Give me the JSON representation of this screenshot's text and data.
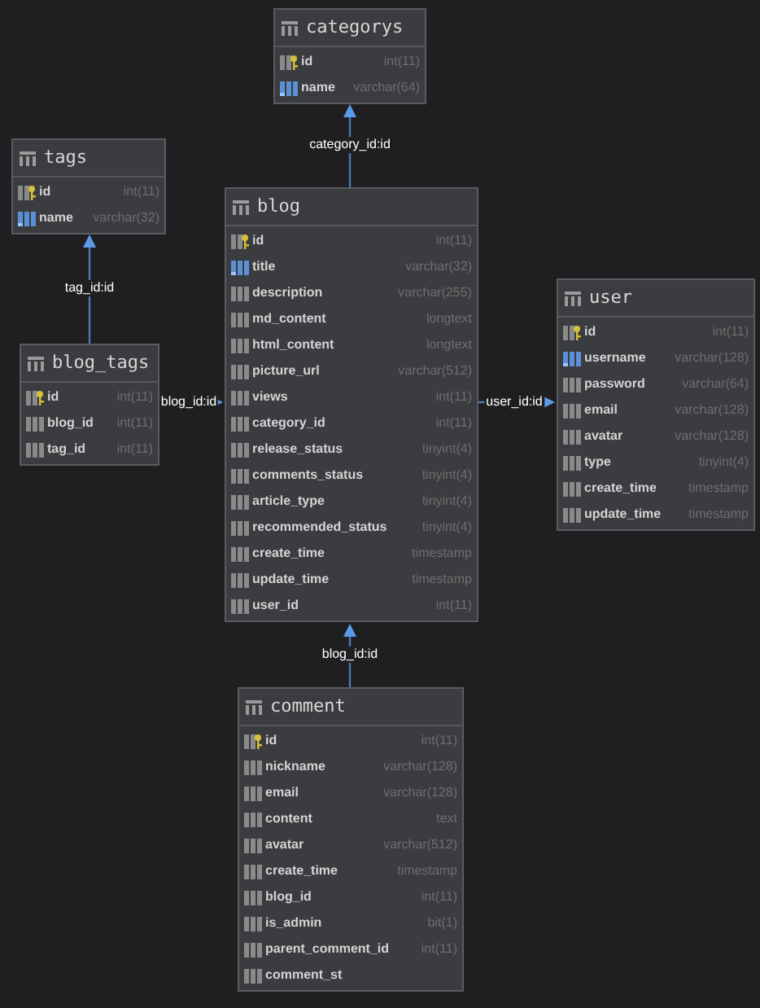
{
  "tables": [
    {
      "name": "categorys",
      "columns": [
        {
          "name": "id",
          "type": "int(11)",
          "kind": "key"
        },
        {
          "name": "name",
          "type": "varchar(64)",
          "kind": "indexed"
        }
      ]
    },
    {
      "name": "tags",
      "columns": [
        {
          "name": "id",
          "type": "int(11)",
          "kind": "key"
        },
        {
          "name": "name",
          "type": "varchar(32)",
          "kind": "indexed"
        }
      ]
    },
    {
      "name": "blog_tags",
      "columns": [
        {
          "name": "id",
          "type": "int(11)",
          "kind": "key"
        },
        {
          "name": "blog_id",
          "type": "int(11)",
          "kind": "plain"
        },
        {
          "name": "tag_id",
          "type": "int(11)",
          "kind": "plain"
        }
      ]
    },
    {
      "name": "blog",
      "columns": [
        {
          "name": "id",
          "type": "int(11)",
          "kind": "key"
        },
        {
          "name": "title",
          "type": "varchar(32)",
          "kind": "indexed"
        },
        {
          "name": "description",
          "type": "varchar(255)",
          "kind": "plain"
        },
        {
          "name": "md_content",
          "type": "longtext",
          "kind": "plain"
        },
        {
          "name": "html_content",
          "type": "longtext",
          "kind": "plain"
        },
        {
          "name": "picture_url",
          "type": "varchar(512)",
          "kind": "plain"
        },
        {
          "name": "views",
          "type": "int(11)",
          "kind": "plain"
        },
        {
          "name": "category_id",
          "type": "int(11)",
          "kind": "plain"
        },
        {
          "name": "release_status",
          "type": "tinyint(4)",
          "kind": "plain"
        },
        {
          "name": "comments_status",
          "type": "tinyint(4)",
          "kind": "plain"
        },
        {
          "name": "article_type",
          "type": "tinyint(4)",
          "kind": "plain"
        },
        {
          "name": "recommended_status",
          "type": "tinyint(4)",
          "kind": "plain"
        },
        {
          "name": "create_time",
          "type": "timestamp",
          "kind": "plain"
        },
        {
          "name": "update_time",
          "type": "timestamp",
          "kind": "plain"
        },
        {
          "name": "user_id",
          "type": "int(11)",
          "kind": "plain"
        }
      ]
    },
    {
      "name": "user",
      "columns": [
        {
          "name": "id",
          "type": "int(11)",
          "kind": "key"
        },
        {
          "name": "username",
          "type": "varchar(128)",
          "kind": "indexed"
        },
        {
          "name": "password",
          "type": "varchar(64)",
          "kind": "plain"
        },
        {
          "name": "email",
          "type": "varchar(128)",
          "kind": "plain"
        },
        {
          "name": "avatar",
          "type": "varchar(128)",
          "kind": "plain"
        },
        {
          "name": "type",
          "type": "tinyint(4)",
          "kind": "plain"
        },
        {
          "name": "create_time",
          "type": "timestamp",
          "kind": "plain"
        },
        {
          "name": "update_time",
          "type": "timestamp",
          "kind": "plain"
        }
      ]
    },
    {
      "name": "comment",
      "columns": [
        {
          "name": "id",
          "type": "int(11)",
          "kind": "key"
        },
        {
          "name": "nickname",
          "type": "varchar(128)",
          "kind": "plain"
        },
        {
          "name": "email",
          "type": "varchar(128)",
          "kind": "plain"
        },
        {
          "name": "content",
          "type": "text",
          "kind": "plain"
        },
        {
          "name": "avatar",
          "type": "varchar(512)",
          "kind": "plain"
        },
        {
          "name": "create_time",
          "type": "timestamp",
          "kind": "plain"
        },
        {
          "name": "blog_id",
          "type": "int(11)",
          "kind": "plain"
        },
        {
          "name": "is_admin",
          "type": "bit(1)",
          "kind": "plain"
        },
        {
          "name": "parent_comment_id",
          "type": "int(11)",
          "kind": "plain"
        },
        {
          "name": "comment_st",
          "kind": "plain"
        }
      ]
    }
  ],
  "relations": [
    {
      "label": "category_id:id"
    },
    {
      "label": "tag_id:id"
    },
    {
      "label": "blog_id:id"
    },
    {
      "label": "user_id:id"
    },
    {
      "label": "blog_id:id"
    }
  ]
}
